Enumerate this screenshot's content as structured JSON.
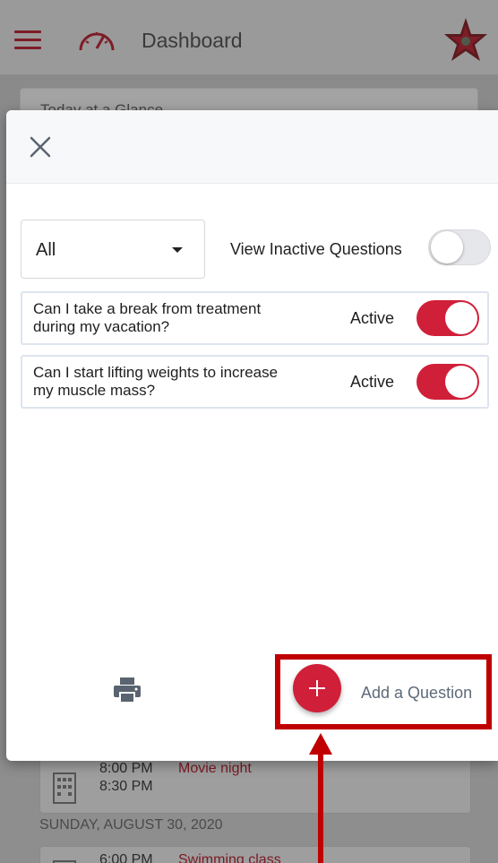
{
  "app_bar": {
    "title": "Dashboard"
  },
  "background": {
    "card_peek_text": "Today at a Glance",
    "events": [
      {
        "start": "8:00 PM",
        "end": "8:30 PM",
        "name": "Movie night"
      },
      {
        "start": "6:00 PM",
        "name": "Swimming class"
      }
    ],
    "date_header": "SUNDAY, AUGUST 30, 2020"
  },
  "modal": {
    "filter": {
      "selected": "All"
    },
    "view_inactive": {
      "label": "View Inactive Questions",
      "enabled": false
    },
    "questions": [
      {
        "text": "Can I take a break from treatment during my vacation?",
        "status": "Active",
        "enabled": true
      },
      {
        "text": "Can I start lifting weights to increase my muscle mass?",
        "status": "Active",
        "enabled": true
      }
    ],
    "footer": {
      "add_label": "Add a Question"
    }
  },
  "colors": {
    "accent": "#d01f39",
    "annotation": "#c00000",
    "link_text": "#5e6a79"
  },
  "icons": [
    "menu-icon",
    "speedometer-icon",
    "logo-icon",
    "close-icon",
    "chevron-down-icon",
    "print-icon",
    "plus-icon",
    "building-icon"
  ]
}
